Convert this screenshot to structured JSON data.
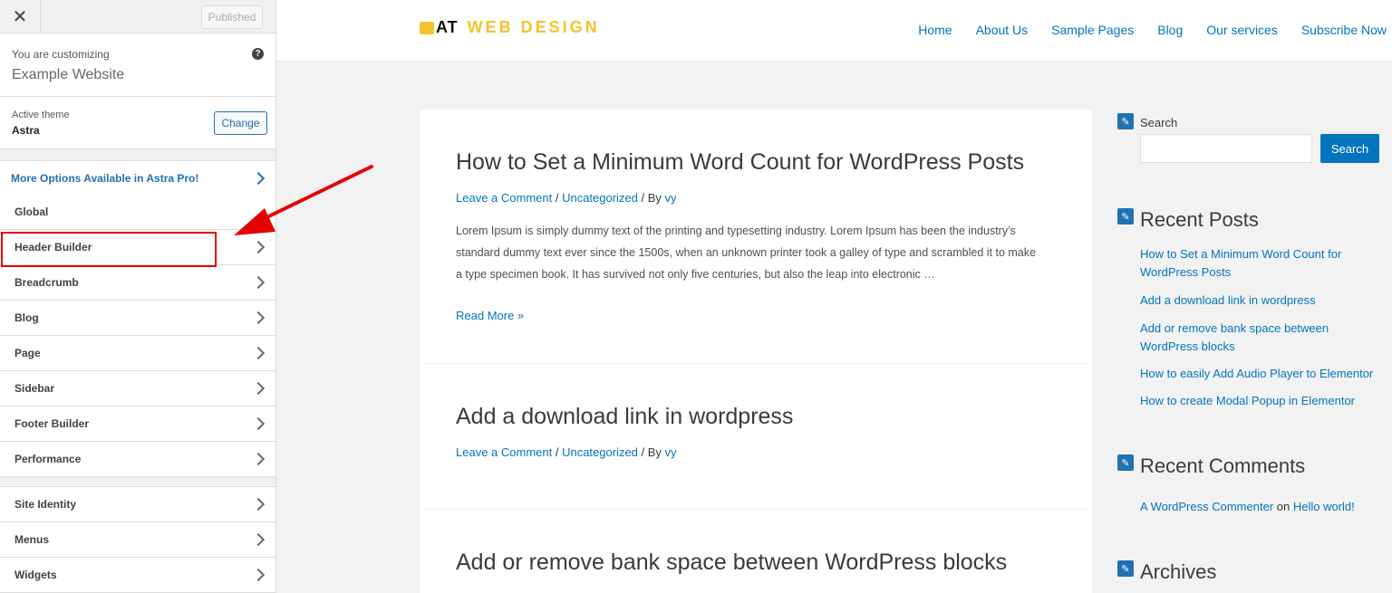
{
  "customizer": {
    "close_icon": "✕",
    "published_label": "Published",
    "customizing_label": "You are customizing",
    "site_name": "Example Website",
    "help_icon": "?",
    "active_theme_label": "Active theme",
    "theme_name": "Astra",
    "change_label": "Change",
    "promo_label": "More Options Available in Astra Pro!",
    "menu_a": [
      "Global",
      "Header Builder",
      "Breadcrumb",
      "Blog",
      "Page",
      "Sidebar",
      "Footer Builder",
      "Performance"
    ],
    "menu_b": [
      "Site Identity",
      "Menus",
      "Widgets"
    ],
    "highlight_color": "#e60000"
  },
  "site": {
    "logo_at": "AT",
    "logo_web_design": "WEB DESIGN",
    "nav": [
      "Home",
      "About Us",
      "Sample Pages",
      "Blog",
      "Our services",
      "Subscribe Now"
    ],
    "posts": [
      {
        "title": "How to Set a Minimum Word Count for WordPress Posts",
        "meta_comment": "Leave a Comment",
        "meta_sep1": " / ",
        "meta_category": "Uncategorized",
        "meta_by": " / By ",
        "meta_author": "vy",
        "excerpt": "Lorem Ipsum is simply dummy text of the printing and typesetting industry. Lorem Ipsum has been the industry’s standard dummy text ever since the 1500s, when an unknown printer took a galley of type and scrambled it to make a type specimen book. It has survived not only five centuries, but also the leap into electronic …",
        "read_more": "Read More »"
      },
      {
        "title": "Add a download link in wordpress",
        "meta_comment": "Leave a Comment",
        "meta_sep1": " / ",
        "meta_category": "Uncategorized",
        "meta_by": " / By ",
        "meta_author": "vy"
      },
      {
        "title": "Add or remove bank space between WordPress blocks"
      }
    ],
    "sidebar": {
      "search_label": "Search",
      "search_button": "Search",
      "recent_posts_title": "Recent Posts",
      "recent_posts": [
        "How to Set a Minimum Word Count for WordPress Posts",
        "Add a download link in wordpress",
        "Add or remove bank space between WordPress blocks",
        "How to easily Add Audio Player to Elementor",
        "How to create Modal Popup in Elementor"
      ],
      "recent_comments_title": "Recent Comments",
      "comment_author": "A WordPress Commenter",
      "comment_on": " on ",
      "comment_post": "Hello world!",
      "archives_title": "Archives",
      "widget_icon": "✎"
    },
    "link_color": "#0274be",
    "logo_color": "#f6c22b"
  }
}
